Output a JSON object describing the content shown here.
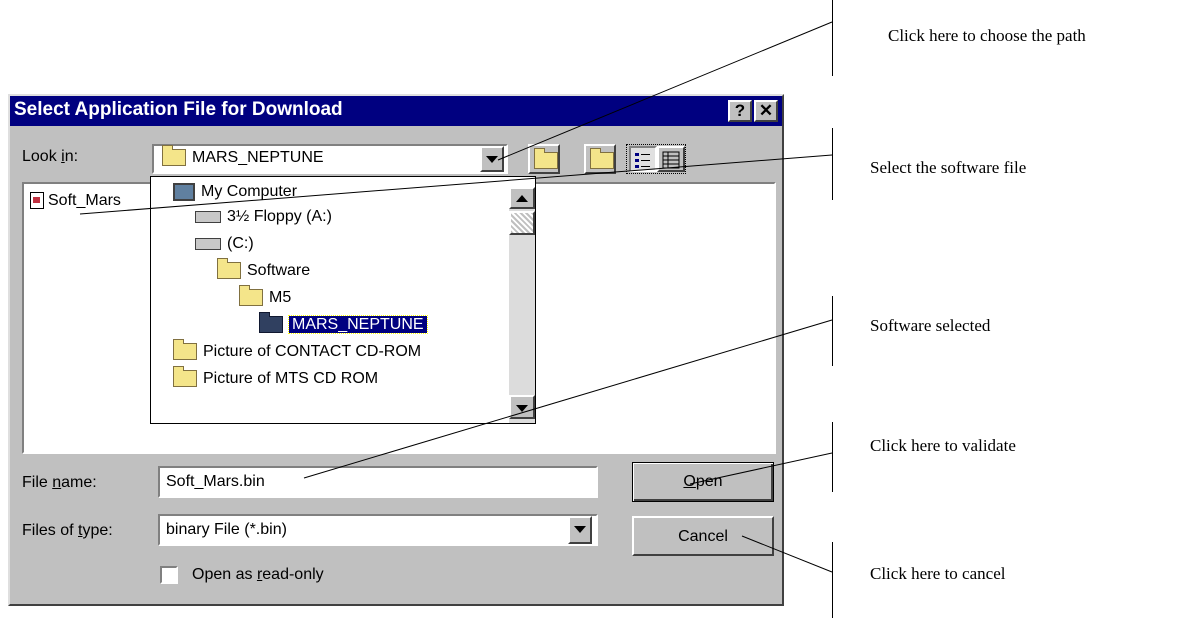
{
  "dialog": {
    "title": "Select Application File for Download",
    "help_btn": "?",
    "close_btn": "✕",
    "look_in_label": "Look in:",
    "look_in_value": "MARS_NEPTUNE",
    "file_list": [
      {
        "name": "Soft_Mars",
        "icon": "bin-file-icon"
      }
    ],
    "tree": [
      {
        "label": "My Computer",
        "icon": "computer-icon"
      },
      {
        "label": "3½ Floppy (A:)",
        "icon": "floppy-drive-icon"
      },
      {
        "label": "(C:)",
        "icon": "hard-drive-icon"
      },
      {
        "label": "Software",
        "icon": "folder-icon"
      },
      {
        "label": "M5",
        "icon": "folder-icon"
      },
      {
        "label": "MARS_NEPTUNE",
        "icon": "open-folder-icon",
        "selected": true
      },
      {
        "label": "Picture of CONTACT CD-ROM",
        "icon": "folder-icon"
      },
      {
        "label": "Picture of MTS CD ROM",
        "icon": "folder-icon"
      }
    ],
    "file_name_label": "File name:",
    "file_name_value": "Soft_Mars.bin",
    "files_type_label": "Files of type:",
    "files_type_value": "binary File (*.bin)",
    "open_btn": "Open",
    "cancel_btn": "Cancel",
    "readonly_label": "Open as read-only",
    "readonly_checked": false
  },
  "annotations": {
    "choose_path": "Click here to choose the path",
    "select_file": "Select the software file",
    "software_selected": "Software selected",
    "validate": "Click here to validate",
    "cancel": "Click here to cancel"
  }
}
